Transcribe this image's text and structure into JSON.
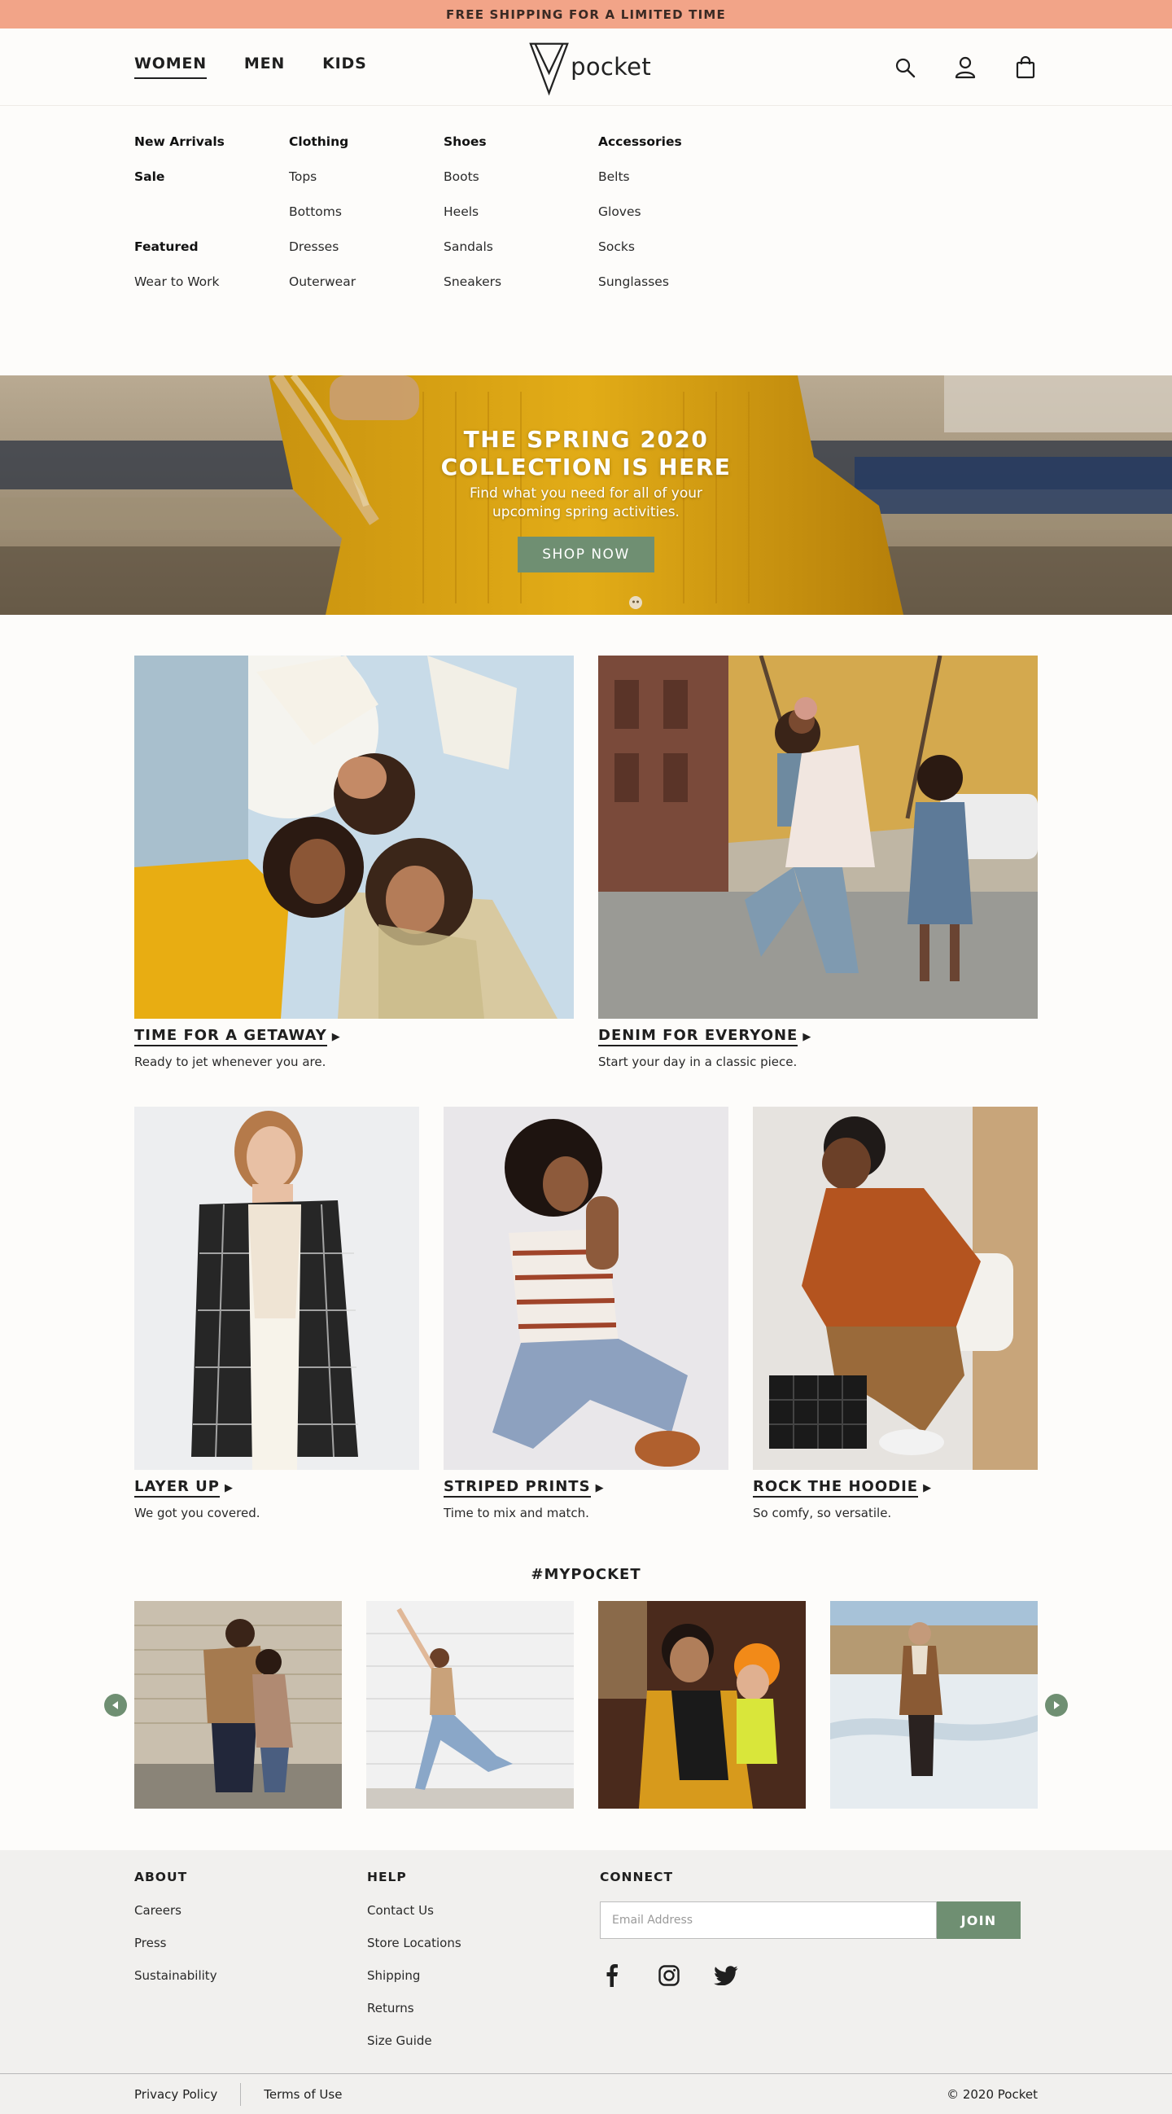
{
  "promo": {
    "text": "FREE SHIPPING FOR A LIMITED TIME",
    "color": "#f2a488"
  },
  "brand": {
    "name": "pocket",
    "accent": "#6f8f72"
  },
  "nav": {
    "items": [
      "WOMEN",
      "MEN",
      "KIDS"
    ],
    "active": "WOMEN"
  },
  "header_icons": [
    "search-icon",
    "account-icon",
    "bag-icon"
  ],
  "mega_menu": {
    "col1": {
      "a": "New Arrivals",
      "b": "Sale",
      "c": "Featured",
      "d": "Wear to Work"
    },
    "col2": {
      "heading": "Clothing",
      "items": [
        "Tops",
        "Bottoms",
        "Dresses",
        "Outerwear"
      ]
    },
    "col3": {
      "heading": "Shoes",
      "items": [
        "Boots",
        "Heels",
        "Sandals",
        "Sneakers"
      ]
    },
    "col4": {
      "heading": "Accessories",
      "items": [
        "Belts",
        "Gloves",
        "Socks",
        "Sunglasses"
      ]
    }
  },
  "hero": {
    "title_line1": "THE SPRING 2020",
    "title_line2": "COLLECTION IS HERE",
    "subtitle": "Find what you need for all of your upcoming spring activities.",
    "button": "SHOP NOW"
  },
  "features_two": [
    {
      "title": "TIME FOR A GETAWAY",
      "subtitle": "Ready to jet whenever you are."
    },
    {
      "title": "DENIM FOR EVERYONE",
      "subtitle": "Start your day in a classic piece."
    }
  ],
  "features_three": [
    {
      "title": "LAYER UP",
      "subtitle": "We got you covered."
    },
    {
      "title": "STRIPED PRINTS",
      "subtitle": "Time to mix and match."
    },
    {
      "title": "ROCK THE HOODIE",
      "subtitle": "So comfy, so versatile."
    }
  ],
  "social": {
    "title": "#MYPOCKET"
  },
  "footer": {
    "about": {
      "heading": "ABOUT",
      "links": [
        "Careers",
        "Press",
        "Sustainability"
      ]
    },
    "help": {
      "heading": "HELP",
      "links": [
        "Contact Us",
        "Store Locations",
        "Shipping",
        "Returns",
        "Size Guide"
      ]
    },
    "connect": {
      "heading": "CONNECT",
      "email_placeholder": "Email Address",
      "join": "JOIN"
    },
    "social_icons": [
      "facebook-icon",
      "instagram-icon",
      "twitter-icon"
    ],
    "bottom": {
      "privacy": "Privacy Policy",
      "terms": "Terms of Use",
      "copyright": "© 2020 Pocket"
    }
  }
}
